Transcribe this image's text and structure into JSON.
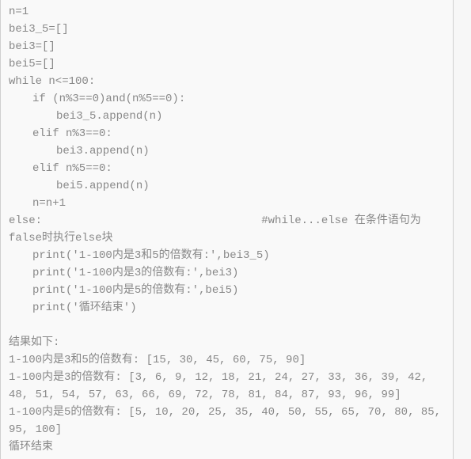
{
  "code": {
    "l01": "n=1",
    "l02": "bei3_5=[]",
    "l03": "bei3=[]",
    "l04": "bei5=[]",
    "l05": "while n<=100:",
    "l06": "if (n%3==0)and(n%5==0):",
    "l07": "bei3_5.append(n)",
    "l08": "elif n%3==0:",
    "l09": "bei3.append(n)",
    "l10": "elif n%5==0:",
    "l11": "bei5.append(n)",
    "l12": "n=n+1",
    "l13": "else:                                 #while...else 在条件语句为false时执行else块",
    "l14": "print('1-100内是3和5的倍数有:',bei3_5)",
    "l15": "print('1-100内是3的倍数有:',bei3)",
    "l16": "print('1-100内是5的倍数有:',bei5)",
    "l17": "print('循环结束')"
  },
  "output": {
    "header": "结果如下:",
    "r1": "1-100内是3和5的倍数有: [15, 30, 45, 60, 75, 90]",
    "r2": "1-100内是3的倍数有: [3, 6, 9, 12, 18, 21, 24, 27, 33, 36, 39, 42, 48, 51, 54, 57, 63, 66, 69, 72, 78, 81, 84, 87, 93, 96, 99]",
    "r3": "1-100内是5的倍数有: [5, 10, 20, 25, 35, 40, 50, 55, 65, 70, 80, 85, 95, 100]",
    "r4": "循环结束"
  }
}
